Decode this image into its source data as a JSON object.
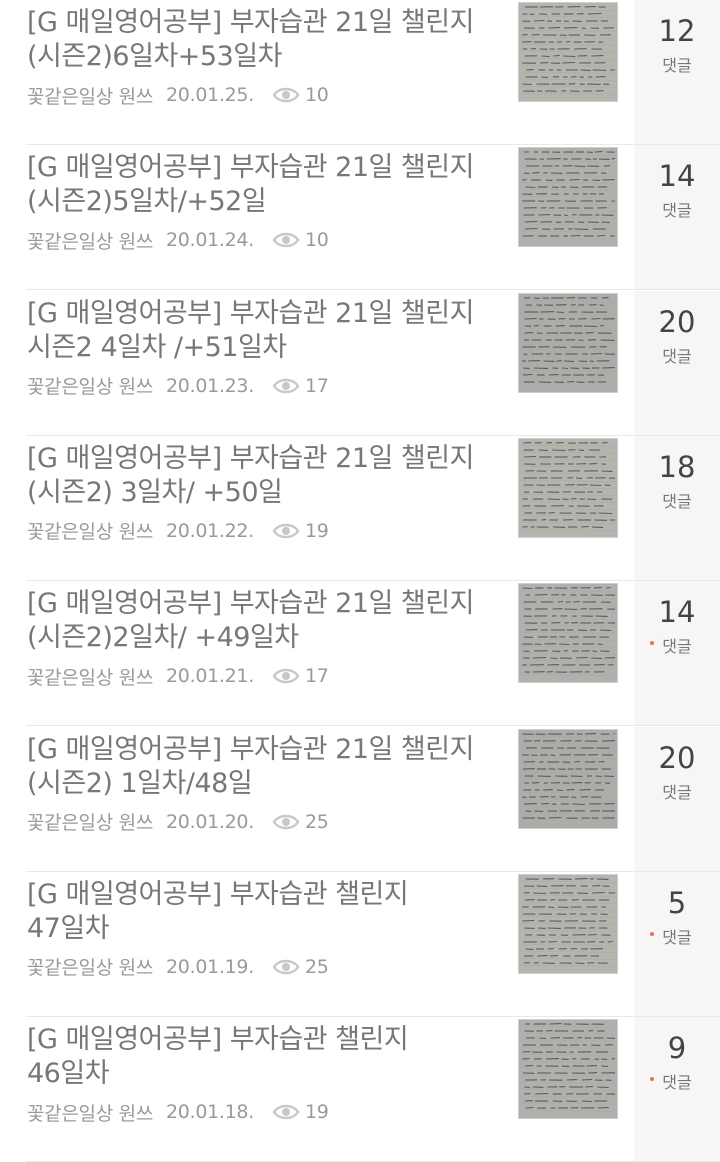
{
  "posts": [
    {
      "title": "[G 매일영어공부] 부자습관 21일 챌린지 (시즌2)6일차+53일차",
      "author": "꽃같은일상 원쓰",
      "date": "20.01.25.",
      "views": "10",
      "comments": "12",
      "comment_label": "댓글",
      "new_comment": false
    },
    {
      "title": "[G 매일영어공부] 부자습관 21일 챌린지 (시즌2)5일차/+52일",
      "author": "꽃같은일상 원쓰",
      "date": "20.01.24.",
      "views": "10",
      "comments": "14",
      "comment_label": "댓글",
      "new_comment": false
    },
    {
      "title": "[G 매일영어공부] 부자습관 21일 챌린지 시즌2 4일차 /+51일차",
      "author": "꽃같은일상 원쓰",
      "date": "20.01.23.",
      "views": "17",
      "comments": "20",
      "comment_label": "댓글",
      "new_comment": false
    },
    {
      "title": "[G 매일영어공부] 부자습관 21일 챌린지 (시즌2) 3일차/ +50일",
      "author": "꽃같은일상 원쓰",
      "date": "20.01.22.",
      "views": "19",
      "comments": "18",
      "comment_label": "댓글",
      "new_comment": false
    },
    {
      "title": "[G 매일영어공부] 부자습관 21일 챌린지 (시즌2)2일차/ +49일차",
      "author": "꽃같은일상 원쓰",
      "date": "20.01.21.",
      "views": "17",
      "comments": "14",
      "comment_label": "댓글",
      "new_comment": true
    },
    {
      "title": "[G 매일영어공부] 부자습관 21일 챌린지 (시즌2) 1일차/48일",
      "author": "꽃같은일상 원쓰",
      "date": "20.01.20.",
      "views": "25",
      "comments": "20",
      "comment_label": "댓글",
      "new_comment": false
    },
    {
      "title": "[G 매일영어공부] 부자습관 챌린지 47일차",
      "author": "꽃같은일상 원쓰",
      "date": "20.01.19.",
      "views": "25",
      "comments": "5",
      "comment_label": "댓글",
      "new_comment": true
    },
    {
      "title": "[G 매일영어공부] 부자습관 챌린지 46일차",
      "author": "꽃같은일상 원쓰",
      "date": "20.01.18.",
      "views": "19",
      "comments": "9",
      "comment_label": "댓글",
      "new_comment": true
    }
  ],
  "icons": {
    "views": "eye-icon",
    "thumbnail": "notebook-photo"
  },
  "colors": {
    "title": "#777777",
    "meta": "#9a9a9a",
    "comment_count": "#444444",
    "comment_box_bg": "#f6f6f6",
    "new_dot": "#f26a63",
    "divider": "#e9e9e9"
  }
}
